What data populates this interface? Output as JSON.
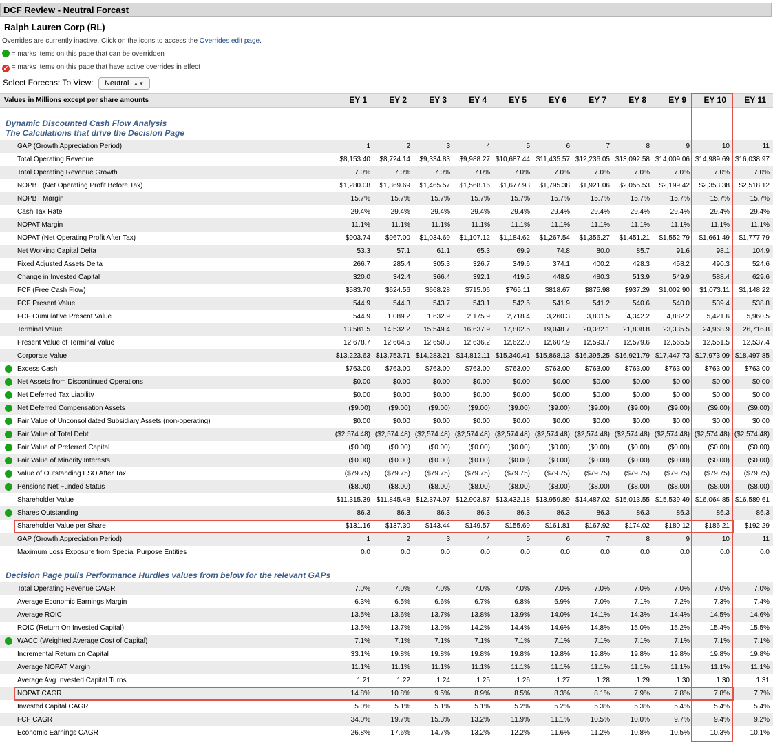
{
  "window": {
    "title": "DCF Review - Neutral Forcast"
  },
  "company": "Ralph Lauren Corp (RL)",
  "overrides_note": {
    "prefix": "Overrides are currently inactive. Click on the icons to access the ",
    "link": "Overrides edit page",
    "suffix": "."
  },
  "legend": {
    "overridable": "= marks items on this page that can be overridden",
    "active": "= marks items on this page that have active overrides in effect"
  },
  "forecast_select": {
    "label": "Select Forecast To View:",
    "value": "Neutral"
  },
  "table": {
    "header_label": "Values in Millions except per share amounts",
    "columns": [
      "EY 1",
      "EY 2",
      "EY 3",
      "EY 4",
      "EY 5",
      "EY 6",
      "EY 7",
      "EY 8",
      "EY 9",
      "EY 10",
      "EY 11"
    ]
  },
  "section1": {
    "title": "Dynamic Discounted Cash Flow Analysis",
    "subtitle": "The Calculations that drive the Decision Page",
    "rows": [
      {
        "label": "GAP (Growth Appreciation Period)",
        "ov": false,
        "values": [
          "1",
          "2",
          "3",
          "4",
          "5",
          "6",
          "7",
          "8",
          "9",
          "10",
          "11"
        ]
      },
      {
        "label": "Total Operating Revenue",
        "ov": false,
        "values": [
          "$8,153.40",
          "$8,724.14",
          "$9,334.83",
          "$9,988.27",
          "$10,687.44",
          "$11,435.57",
          "$12,236.05",
          "$13,092.58",
          "$14,009.06",
          "$14,989.69",
          "$16,038.97"
        ]
      },
      {
        "label": "Total Operating Revenue Growth",
        "ov": false,
        "values": [
          "7.0%",
          "7.0%",
          "7.0%",
          "7.0%",
          "7.0%",
          "7.0%",
          "7.0%",
          "7.0%",
          "7.0%",
          "7.0%",
          "7.0%"
        ]
      },
      {
        "label": "NOPBT (Net Operating Profit Before Tax)",
        "ov": false,
        "values": [
          "$1,280.08",
          "$1,369.69",
          "$1,465.57",
          "$1,568.16",
          "$1,677.93",
          "$1,795.38",
          "$1,921.06",
          "$2,055.53",
          "$2,199.42",
          "$2,353.38",
          "$2,518.12"
        ]
      },
      {
        "label": "NOPBT Margin",
        "ov": false,
        "values": [
          "15.7%",
          "15.7%",
          "15.7%",
          "15.7%",
          "15.7%",
          "15.7%",
          "15.7%",
          "15.7%",
          "15.7%",
          "15.7%",
          "15.7%"
        ]
      },
      {
        "label": "Cash Tax Rate",
        "ov": false,
        "values": [
          "29.4%",
          "29.4%",
          "29.4%",
          "29.4%",
          "29.4%",
          "29.4%",
          "29.4%",
          "29.4%",
          "29.4%",
          "29.4%",
          "29.4%"
        ]
      },
      {
        "label": "NOPAT Margin",
        "ov": false,
        "values": [
          "11.1%",
          "11.1%",
          "11.1%",
          "11.1%",
          "11.1%",
          "11.1%",
          "11.1%",
          "11.1%",
          "11.1%",
          "11.1%",
          "11.1%"
        ]
      },
      {
        "label": "NOPAT (Net Operating Profit After Tax)",
        "ov": false,
        "values": [
          "$903.74",
          "$967.00",
          "$1,034.69",
          "$1,107.12",
          "$1,184.62",
          "$1,267.54",
          "$1,356.27",
          "$1,451.21",
          "$1,552.79",
          "$1,661.49",
          "$1,777.79"
        ]
      },
      {
        "label": "Net Working Capital Delta",
        "ov": false,
        "values": [
          "53.3",
          "57.1",
          "61.1",
          "65.3",
          "69.9",
          "74.8",
          "80.0",
          "85.7",
          "91.6",
          "98.1",
          "104.9"
        ]
      },
      {
        "label": "Fixed Adjusted Assets Delta",
        "ov": false,
        "values": [
          "266.7",
          "285.4",
          "305.3",
          "326.7",
          "349.6",
          "374.1",
          "400.2",
          "428.3",
          "458.2",
          "490.3",
          "524.6"
        ]
      },
      {
        "label": "Change in Invested Capital",
        "ov": false,
        "values": [
          "320.0",
          "342.4",
          "366.4",
          "392.1",
          "419.5",
          "448.9",
          "480.3",
          "513.9",
          "549.9",
          "588.4",
          "629.6"
        ]
      },
      {
        "label": "FCF (Free Cash Flow)",
        "ov": false,
        "values": [
          "$583.70",
          "$624.56",
          "$668.28",
          "$715.06",
          "$765.11",
          "$818.67",
          "$875.98",
          "$937.29",
          "$1,002.90",
          "$1,073.11",
          "$1,148.22"
        ]
      },
      {
        "label": "FCF Present Value",
        "ov": false,
        "values": [
          "544.9",
          "544.3",
          "543.7",
          "543.1",
          "542.5",
          "541.9",
          "541.2",
          "540.6",
          "540.0",
          "539.4",
          "538.8"
        ]
      },
      {
        "label": "FCF Cumulative Present Value",
        "ov": false,
        "values": [
          "544.9",
          "1,089.2",
          "1,632.9",
          "2,175.9",
          "2,718.4",
          "3,260.3",
          "3,801.5",
          "4,342.2",
          "4,882.2",
          "5,421.6",
          "5,960.5"
        ]
      },
      {
        "label": "Terminal Value",
        "ov": false,
        "values": [
          "13,581.5",
          "14,532.2",
          "15,549.4",
          "16,637.9",
          "17,802.5",
          "19,048.7",
          "20,382.1",
          "21,808.8",
          "23,335.5",
          "24,968.9",
          "26,716.8"
        ]
      },
      {
        "label": "Present Value of Terminal Value",
        "ov": false,
        "values": [
          "12,678.7",
          "12,664.5",
          "12,650.3",
          "12,636.2",
          "12,622.0",
          "12,607.9",
          "12,593.7",
          "12,579.6",
          "12,565.5",
          "12,551.5",
          "12,537.4"
        ]
      },
      {
        "label": "Corporate Value",
        "ov": false,
        "values": [
          "$13,223.63",
          "$13,753.71",
          "$14,283.21",
          "$14,812.11",
          "$15,340.41",
          "$15,868.13",
          "$16,395.25",
          "$16,921.79",
          "$17,447.73",
          "$17,973.09",
          "$18,497.85"
        ]
      },
      {
        "label": "Excess Cash",
        "ov": true,
        "values": [
          "$763.00",
          "$763.00",
          "$763.00",
          "$763.00",
          "$763.00",
          "$763.00",
          "$763.00",
          "$763.00",
          "$763.00",
          "$763.00",
          "$763.00"
        ]
      },
      {
        "label": "Net Assets from Discontinued Operations",
        "ov": true,
        "values": [
          "$0.00",
          "$0.00",
          "$0.00",
          "$0.00",
          "$0.00",
          "$0.00",
          "$0.00",
          "$0.00",
          "$0.00",
          "$0.00",
          "$0.00"
        ]
      },
      {
        "label": "Net Deferred Tax Liability",
        "ov": true,
        "values": [
          "$0.00",
          "$0.00",
          "$0.00",
          "$0.00",
          "$0.00",
          "$0.00",
          "$0.00",
          "$0.00",
          "$0.00",
          "$0.00",
          "$0.00"
        ]
      },
      {
        "label": "Net Deferred Compensation Assets",
        "ov": true,
        "values": [
          "($9.00)",
          "($9.00)",
          "($9.00)",
          "($9.00)",
          "($9.00)",
          "($9.00)",
          "($9.00)",
          "($9.00)",
          "($9.00)",
          "($9.00)",
          "($9.00)"
        ]
      },
      {
        "label": "Fair Value of Unconsolidated Subsidiary Assets (non-operating)",
        "ov": true,
        "values": [
          "$0.00",
          "$0.00",
          "$0.00",
          "$0.00",
          "$0.00",
          "$0.00",
          "$0.00",
          "$0.00",
          "$0.00",
          "$0.00",
          "$0.00"
        ]
      },
      {
        "label": "Fair Value of Total Debt",
        "ov": true,
        "values": [
          "($2,574.48)",
          "($2,574.48)",
          "($2,574.48)",
          "($2,574.48)",
          "($2,574.48)",
          "($2,574.48)",
          "($2,574.48)",
          "($2,574.48)",
          "($2,574.48)",
          "($2,574.48)",
          "($2,574.48)"
        ]
      },
      {
        "label": "Fair Value of Preferred Capital",
        "ov": true,
        "values": [
          "($0.00)",
          "($0.00)",
          "($0.00)",
          "($0.00)",
          "($0.00)",
          "($0.00)",
          "($0.00)",
          "($0.00)",
          "($0.00)",
          "($0.00)",
          "($0.00)"
        ]
      },
      {
        "label": "Fair Value of Minority Interests",
        "ov": true,
        "values": [
          "($0.00)",
          "($0.00)",
          "($0.00)",
          "($0.00)",
          "($0.00)",
          "($0.00)",
          "($0.00)",
          "($0.00)",
          "($0.00)",
          "($0.00)",
          "($0.00)"
        ]
      },
      {
        "label": "Value of Outstanding ESO After Tax",
        "ov": true,
        "values": [
          "($79.75)",
          "($79.75)",
          "($79.75)",
          "($79.75)",
          "($79.75)",
          "($79.75)",
          "($79.75)",
          "($79.75)",
          "($79.75)",
          "($79.75)",
          "($79.75)"
        ]
      },
      {
        "label": "Pensions Net Funded Status",
        "ov": true,
        "values": [
          "($8.00)",
          "($8.00)",
          "($8.00)",
          "($8.00)",
          "($8.00)",
          "($8.00)",
          "($8.00)",
          "($8.00)",
          "($8.00)",
          "($8.00)",
          "($8.00)"
        ]
      },
      {
        "label": "Shareholder Value",
        "ov": false,
        "values": [
          "$11,315.39",
          "$11,845.48",
          "$12,374.97",
          "$12,903.87",
          "$13,432.18",
          "$13,959.89",
          "$14,487.02",
          "$15,013.55",
          "$15,539.49",
          "$16,064.85",
          "$16,589.61"
        ]
      },
      {
        "label": "Shares Outstanding",
        "ov": true,
        "values": [
          "86.3",
          "86.3",
          "86.3",
          "86.3",
          "86.3",
          "86.3",
          "86.3",
          "86.3",
          "86.3",
          "86.3",
          "86.3"
        ]
      },
      {
        "label": "Shareholder Value per Share",
        "ov": false,
        "values": [
          "$131.16",
          "$137.30",
          "$143.44",
          "$149.57",
          "$155.69",
          "$161.81",
          "$167.92",
          "$174.02",
          "$180.12",
          "$186.21",
          "$192.29"
        ]
      },
      {
        "label": "GAP (Growth Appreciation Period)",
        "ov": false,
        "values": [
          "1",
          "2",
          "3",
          "4",
          "5",
          "6",
          "7",
          "8",
          "9",
          "10",
          "11"
        ]
      },
      {
        "label": "Maximum Loss Exposure from Special Purpose Entities",
        "ov": false,
        "values": [
          "0.0",
          "0.0",
          "0.0",
          "0.0",
          "0.0",
          "0.0",
          "0.0",
          "0.0",
          "0.0",
          "0.0",
          "0.0"
        ]
      }
    ]
  },
  "section2": {
    "title": "Decision Page pulls Performance Hurdles values from below for the relevant GAPs",
    "rows": [
      {
        "label": "Total Operating Revenue CAGR",
        "ov": false,
        "values": [
          "7.0%",
          "7.0%",
          "7.0%",
          "7.0%",
          "7.0%",
          "7.0%",
          "7.0%",
          "7.0%",
          "7.0%",
          "7.0%",
          "7.0%"
        ]
      },
      {
        "label": "Average Economic Earnings Margin",
        "ov": false,
        "values": [
          "6.3%",
          "6.5%",
          "6.6%",
          "6.7%",
          "6.8%",
          "6.9%",
          "7.0%",
          "7.1%",
          "7.2%",
          "7.3%",
          "7.4%"
        ]
      },
      {
        "label": "Average ROIC",
        "ov": false,
        "values": [
          "13.5%",
          "13.6%",
          "13.7%",
          "13.8%",
          "13.9%",
          "14.0%",
          "14.1%",
          "14.3%",
          "14.4%",
          "14.5%",
          "14.6%"
        ]
      },
      {
        "label": "ROIC (Return On Invested Capital)",
        "ov": false,
        "values": [
          "13.5%",
          "13.7%",
          "13.9%",
          "14.2%",
          "14.4%",
          "14.6%",
          "14.8%",
          "15.0%",
          "15.2%",
          "15.4%",
          "15.5%"
        ]
      },
      {
        "label": "WACC (Weighted Average Cost of Capital)",
        "ov": true,
        "values": [
          "7.1%",
          "7.1%",
          "7.1%",
          "7.1%",
          "7.1%",
          "7.1%",
          "7.1%",
          "7.1%",
          "7.1%",
          "7.1%",
          "7.1%"
        ]
      },
      {
        "label": "Incremental Return on Capital",
        "ov": false,
        "values": [
          "33.1%",
          "19.8%",
          "19.8%",
          "19.8%",
          "19.8%",
          "19.8%",
          "19.8%",
          "19.8%",
          "19.8%",
          "19.8%",
          "19.8%"
        ]
      },
      {
        "label": "Average NOPAT Margin",
        "ov": false,
        "values": [
          "11.1%",
          "11.1%",
          "11.1%",
          "11.1%",
          "11.1%",
          "11.1%",
          "11.1%",
          "11.1%",
          "11.1%",
          "11.1%",
          "11.1%"
        ]
      },
      {
        "label": "Average Avg Invested Capital Turns",
        "ov": false,
        "values": [
          "1.21",
          "1.22",
          "1.24",
          "1.25",
          "1.26",
          "1.27",
          "1.28",
          "1.29",
          "1.30",
          "1.30",
          "1.31"
        ]
      },
      {
        "label": "NOPAT CAGR",
        "ov": false,
        "values": [
          "14.8%",
          "10.8%",
          "9.5%",
          "8.9%",
          "8.5%",
          "8.3%",
          "8.1%",
          "7.9%",
          "7.8%",
          "7.8%",
          "7.7%"
        ]
      },
      {
        "label": "Invested Capital CAGR",
        "ov": false,
        "values": [
          "5.0%",
          "5.1%",
          "5.1%",
          "5.1%",
          "5.2%",
          "5.2%",
          "5.3%",
          "5.3%",
          "5.4%",
          "5.4%",
          "5.4%"
        ]
      },
      {
        "label": "FCF CAGR",
        "ov": false,
        "values": [
          "34.0%",
          "19.7%",
          "15.3%",
          "13.2%",
          "11.9%",
          "11.1%",
          "10.5%",
          "10.0%",
          "9.7%",
          "9.4%",
          "9.2%"
        ]
      },
      {
        "label": "Economic Earnings CAGR",
        "ov": false,
        "values": [
          "26.8%",
          "17.6%",
          "14.7%",
          "13.2%",
          "12.2%",
          "11.6%",
          "11.2%",
          "10.8%",
          "10.5%",
          "10.3%",
          "10.1%"
        ]
      }
    ]
  }
}
